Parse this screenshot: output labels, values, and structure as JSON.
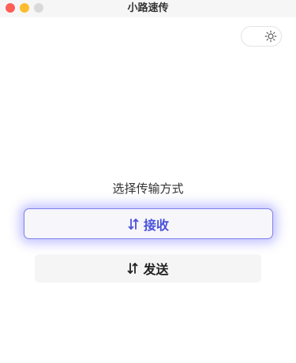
{
  "window": {
    "title": "小路速传"
  },
  "theme_toggle": {
    "icon": "sun-icon"
  },
  "main": {
    "prompt": "选择传输方式",
    "receive_button": {
      "label": "接收",
      "icon": "transfer-arrows-icon"
    },
    "send_button": {
      "label": "发送",
      "icon": "transfer-arrows-icon"
    }
  },
  "colors": {
    "accent": "#4b52d9",
    "accent_border": "#8080ee",
    "close": "#fe5f57",
    "minimize": "#febc2e",
    "zoom": "#d9d9d9"
  }
}
